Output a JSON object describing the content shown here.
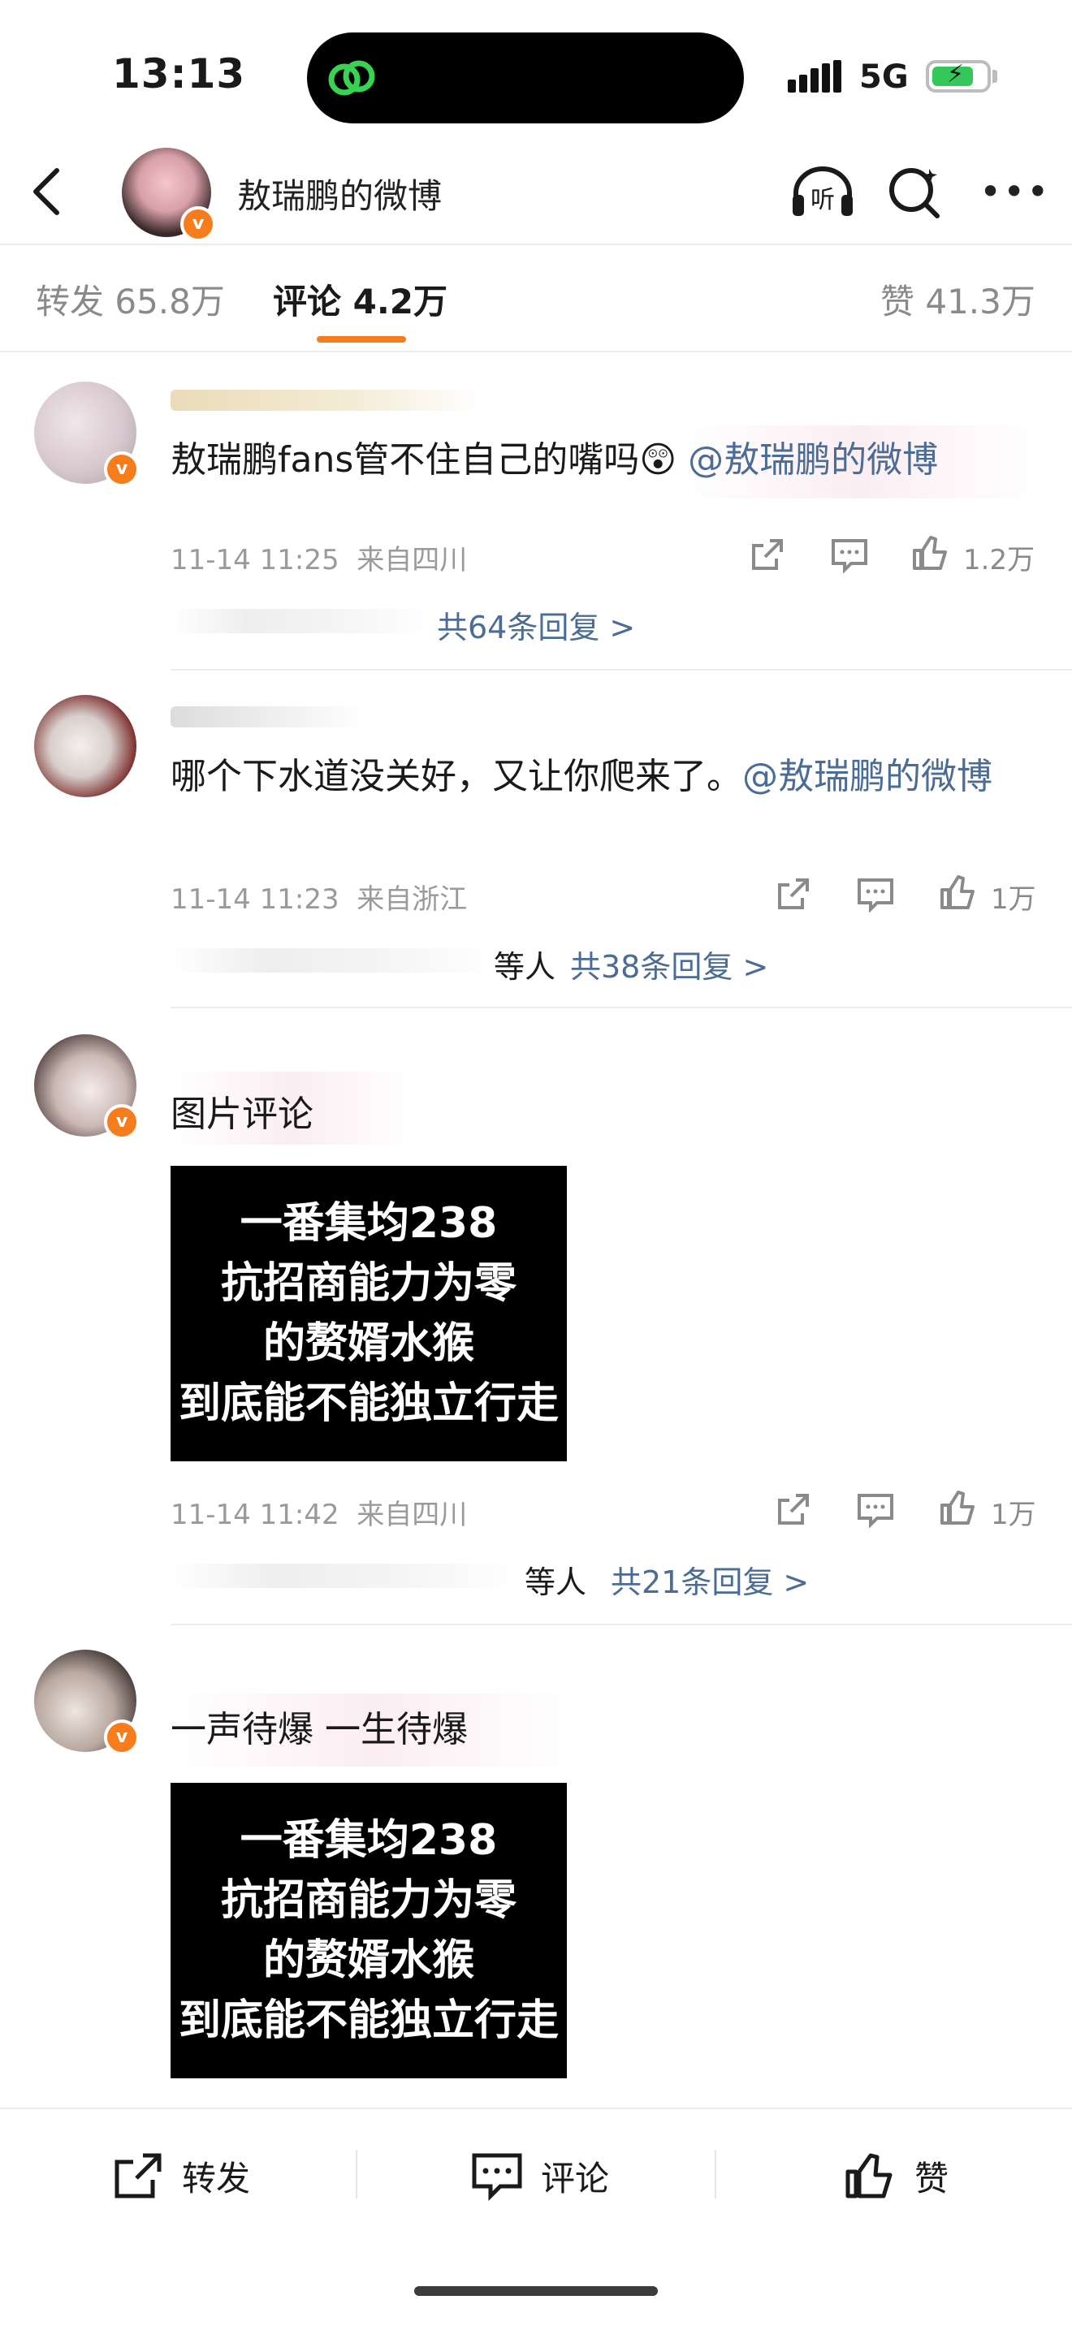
{
  "status_bar": {
    "time": "13:13",
    "network": "5G"
  },
  "header": {
    "title": "敖瑞鹏的微博",
    "listen_label": "听"
  },
  "tabs": [
    {
      "label": "转发 65.8万",
      "active": false
    },
    {
      "label": "评论 4.2万",
      "active": true
    },
    {
      "label": "赞 41.3万",
      "active": false
    }
  ],
  "comments": [
    {
      "text": "敖瑞鹏fans管不住自己的嘴吗😲",
      "mention": "@敖瑞鹏的微博",
      "time": "11-14 11:25",
      "location": "来自四川",
      "likes": "1.2万",
      "replies": "共64条回复 >"
    },
    {
      "text": "哪个下水道没关好，又让你爬来了。",
      "mention": "@敖瑞鹏的微博",
      "time": "11-14 11:23",
      "location": "来自浙江",
      "likes": "1万",
      "replies_prefix": "等人",
      "replies": "共38条回复 >"
    },
    {
      "text": "图片评论",
      "image_lines": [
        "一番集均238",
        "抗招商能力为零",
        "的赘婿水猴",
        "到底能不能独立行走"
      ],
      "time": "11-14 11:42",
      "location": "来自四川",
      "likes": "1万",
      "replies_prefix": "等人",
      "replies": "共21条回复 >"
    },
    {
      "text": "一声待爆 一生待爆",
      "image_lines": [
        "一番集均238",
        "抗招商能力为零",
        "的赘婿水猴",
        "到底能不能独立行走"
      ]
    }
  ],
  "bottom_bar": {
    "repost": "转发",
    "comment": "评论",
    "like": "赞"
  },
  "colors": {
    "accent": "#f77c1b",
    "link": "#4a6c97",
    "meta": "#9a9a9a"
  }
}
